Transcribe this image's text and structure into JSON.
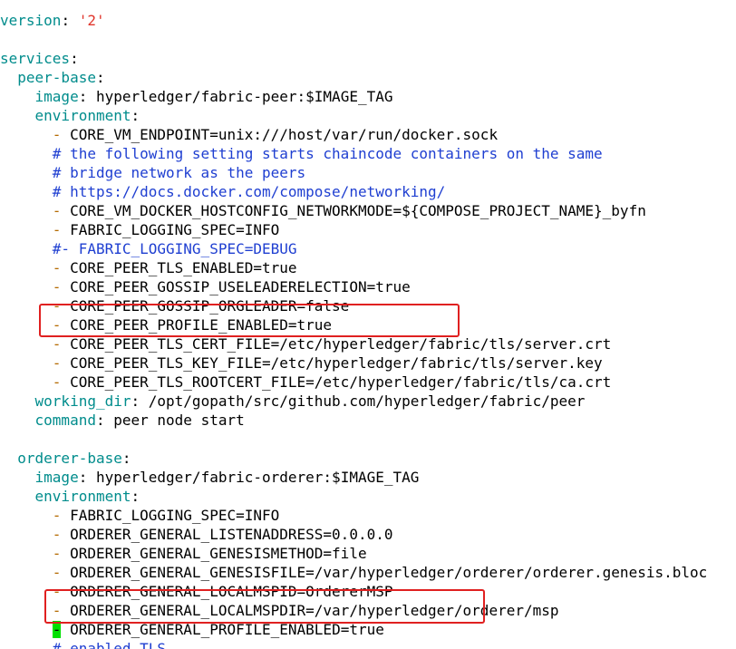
{
  "colors": {
    "key": "#008c8c",
    "string": "#e0352b",
    "comment": "#1f3fd1",
    "dash": "#b46a00",
    "cursor": "#00e000",
    "highlight": "#e02020"
  },
  "lines": [
    {
      "key": "version",
      "sep": ": ",
      "str": "'2'"
    },
    {
      "blank": true
    },
    {
      "key": "services",
      "sep": ":"
    },
    {
      "indent": "  ",
      "key": "peer-base",
      "sep": ":"
    },
    {
      "indent": "    ",
      "key": "image",
      "sep": ": ",
      "val": "hyperledger/fabric-peer:$IMAGE_TAG"
    },
    {
      "indent": "    ",
      "key": "environment",
      "sep": ":"
    },
    {
      "indent": "      ",
      "dash": "- ",
      "val": "CORE_VM_ENDPOINT=unix:///host/var/run/docker.sock"
    },
    {
      "indent": "      ",
      "comment": "# the following setting starts chaincode containers on the same"
    },
    {
      "indent": "      ",
      "comment": "# bridge network as the peers"
    },
    {
      "indent": "      ",
      "comment": "# https://docs.docker.com/compose/networking/"
    },
    {
      "indent": "      ",
      "dash": "- ",
      "val": "CORE_VM_DOCKER_HOSTCONFIG_NETWORKMODE=${COMPOSE_PROJECT_NAME}_byfn"
    },
    {
      "indent": "      ",
      "dash": "- ",
      "val": "FABRIC_LOGGING_SPEC=INFO"
    },
    {
      "indent": "      ",
      "comment": "#- FABRIC_LOGGING_SPEC=DEBUG"
    },
    {
      "indent": "      ",
      "dash": "- ",
      "val": "CORE_PEER_TLS_ENABLED=true"
    },
    {
      "indent": "      ",
      "dash": "- ",
      "val": "CORE_PEER_GOSSIP_USELEADERELECTION=true"
    },
    {
      "indent": "      ",
      "dash": "- ",
      "val": "CORE_PEER_GOSSIP_ORGLEADER=false"
    },
    {
      "indent": "      ",
      "dash": "- ",
      "val": "CORE_PEER_PROFILE_ENABLED=true"
    },
    {
      "indent": "      ",
      "dash": "- ",
      "val": "CORE_PEER_TLS_CERT_FILE=/etc/hyperledger/fabric/tls/server.crt"
    },
    {
      "indent": "      ",
      "dash": "- ",
      "val": "CORE_PEER_TLS_KEY_FILE=/etc/hyperledger/fabric/tls/server.key"
    },
    {
      "indent": "      ",
      "dash": "- ",
      "val": "CORE_PEER_TLS_ROOTCERT_FILE=/etc/hyperledger/fabric/tls/ca.crt"
    },
    {
      "indent": "    ",
      "key": "working_dir",
      "sep": ": ",
      "val": "/opt/gopath/src/github.com/hyperledger/fabric/peer"
    },
    {
      "indent": "    ",
      "key": "command",
      "sep": ": ",
      "val": "peer node start"
    },
    {
      "blank": true
    },
    {
      "indent": "  ",
      "key": "orderer-base",
      "sep": ":"
    },
    {
      "indent": "    ",
      "key": "image",
      "sep": ": ",
      "val": "hyperledger/fabric-orderer:$IMAGE_TAG"
    },
    {
      "indent": "    ",
      "key": "environment",
      "sep": ":"
    },
    {
      "indent": "      ",
      "dash": "- ",
      "val": "FABRIC_LOGGING_SPEC=INFO"
    },
    {
      "indent": "      ",
      "dash": "- ",
      "val": "ORDERER_GENERAL_LISTENADDRESS=0.0.0.0"
    },
    {
      "indent": "      ",
      "dash": "- ",
      "val": "ORDERER_GENERAL_GENESISMETHOD=file"
    },
    {
      "indent": "      ",
      "dash": "- ",
      "val": "ORDERER_GENERAL_GENESISFILE=/var/hyperledger/orderer/orderer.genesis.bloc"
    },
    {
      "indent": "      ",
      "dash": "- ",
      "val": "ORDERER_GENERAL_LOCALMSPID=OrdererMSP"
    },
    {
      "indent": "      ",
      "dash": "- ",
      "val": "ORDERER_GENERAL_LOCALMSPDIR=/var/hyperledger/orderer/msp"
    },
    {
      "indent": "      ",
      "cursor": "-",
      "sp": " ",
      "val": "ORDERER_GENERAL_PROFILE_ENABLED=true"
    },
    {
      "indent": "      ",
      "comment": "# enabled TLS"
    }
  ]
}
